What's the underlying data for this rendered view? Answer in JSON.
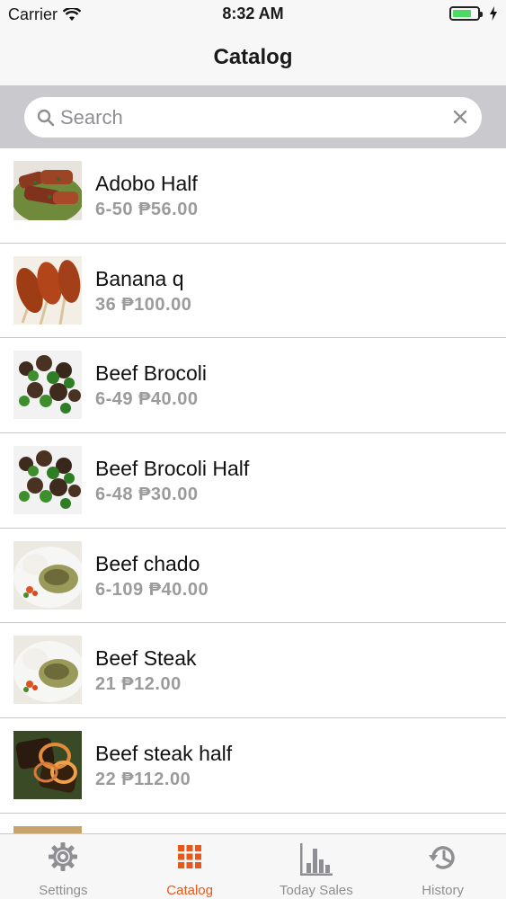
{
  "status_bar": {
    "carrier": "Carrier",
    "time": "8:32 AM"
  },
  "nav": {
    "title": "Catalog"
  },
  "search": {
    "placeholder": "Search"
  },
  "items": [
    {
      "name": "Adobo Half",
      "sub": "6-50  ₱56.00"
    },
    {
      "name": "Banana q",
      "sub": "36  ₱100.00"
    },
    {
      "name": "Beef Brocoli",
      "sub": "6-49  ₱40.00"
    },
    {
      "name": "Beef Brocoli Half",
      "sub": "6-48  ₱30.00"
    },
    {
      "name": "Beef chado",
      "sub": "6-109  ₱40.00"
    },
    {
      "name": "Beef Steak",
      "sub": "21  ₱12.00"
    },
    {
      "name": "Beef steak half",
      "sub": "22  ₱112.00"
    },
    {
      "name": "",
      "sub": ""
    }
  ],
  "tabs": [
    {
      "label": "Settings",
      "icon": "gear-icon"
    },
    {
      "label": "Catalog",
      "icon": "grid-icon"
    },
    {
      "label": "Today Sales",
      "icon": "bar-chart-icon"
    },
    {
      "label": "History",
      "icon": "history-icon"
    }
  ],
  "colors": {
    "accent": "#e8571b",
    "battery": "#4cd964",
    "inactive": "#8e8e93"
  },
  "battery_level": 0.75
}
